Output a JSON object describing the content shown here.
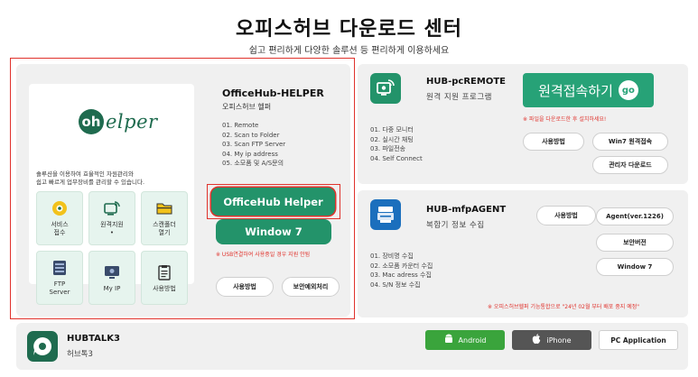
{
  "header": {
    "title": "오피스허브 다운로드 센터",
    "subtitle": "쉽고 편리하게 다양한 솔루션 등 편리하게 이용하세요"
  },
  "helper": {
    "logo_mark": "oh",
    "logo_text": "elper",
    "desc_line1": "솔루션을 이용하여 효율적인 자원관리와",
    "desc_line2": "쉽고 빠르게 업무장비를 관리할 수 있습니다.",
    "tiles": [
      {
        "label": "서비스\n접수",
        "icon": "gear-icon"
      },
      {
        "label": "원격지원\n•",
        "icon": "remote-icon"
      },
      {
        "label": "스캔폴더\n열기",
        "icon": "folder-icon"
      },
      {
        "label": "FTP\nServer",
        "icon": "ftp-server-icon"
      },
      {
        "label": "My IP",
        "icon": "my-ip-icon"
      },
      {
        "label": "사용방법",
        "icon": "clipboard-icon"
      }
    ],
    "title": "OfficeHub-HELPER",
    "sub": "오피스허브 헬퍼",
    "features": [
      "01. Remote",
      "02. Scan to Folder",
      "03. Scan FTP Server",
      "04. My ip address",
      "05. 소모품 및 A/S문의"
    ],
    "download_label": "OfficeHub Helper",
    "win7_label": "Window 7",
    "note": "※ USB연결하여 사용중일 경우 지원 안됨",
    "usage_label": "사용방법",
    "security_label": "보안예외처리",
    "accent_color": "#23936a",
    "highlight_color": "#e0322c"
  },
  "remote": {
    "title": "HUB-pcREMOTE",
    "sub": "원격 지원 프로그램",
    "features": [
      "01. 다중 모니터",
      "02. 실시간 채팅",
      "03. 파일전송",
      "04. Self Connect"
    ],
    "connect_label": "원격접속하기",
    "go_label": "go",
    "note": "※ 파일을 다운로드한 후 설치하세요!",
    "usage_label": "사용방법",
    "win7_label": "Win7 원격접속",
    "admin_label": "관리자 다운로드"
  },
  "mfp": {
    "title": "HUB-mfpAGENT",
    "sub": "복합기 정보 수집",
    "features": [
      "01. 장비명 수집",
      "02. 소모품 카운터 수집",
      "03. Mac adress 수집",
      "04. S/N 정보 수집"
    ],
    "usage_label": "사용방법",
    "agent_label": "Agent(ver.1226)",
    "secv_label": "보안버전",
    "win7_label": "Window 7",
    "note": "※ 오피스허브헬퍼 기능통합으로 \"24년 02월 부터 배포 중지 예정\""
  },
  "talk": {
    "title": "HUBTALK3",
    "sub": "허브톡3",
    "android_label": "Android",
    "iphone_label": "iPhone",
    "pc_label": "PC Application"
  }
}
